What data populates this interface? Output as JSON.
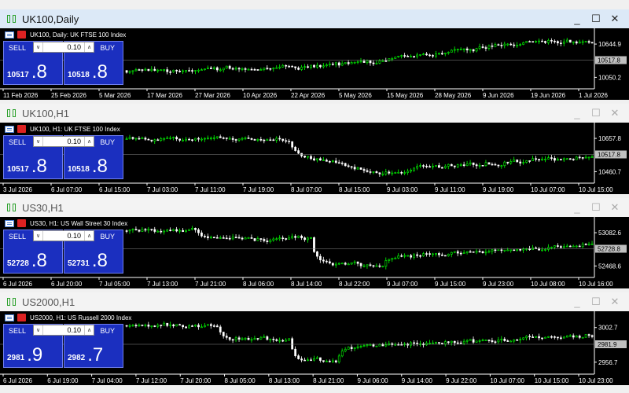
{
  "windows": [
    {
      "title": "UK100,Daily",
      "active": true,
      "header": "UK100, Daily:  UK FTSE 100 Index",
      "sell_label": "SELL",
      "buy_label": "BUY",
      "lot": "0.10",
      "sell_small": "10517",
      "sell_big": ".8",
      "buy_small": "10518",
      "buy_big": ".8",
      "y_ticks": [
        "10644.9",
        "10517.8",
        "10050.2"
      ],
      "current": "10517.8",
      "x_ticks": [
        "11 Feb 2026",
        "25 Feb 2026",
        "5 Mar 2026",
        "17 Mar 2026",
        "27 Mar 2026",
        "10 Apr 2026",
        "22 Apr 2026",
        "5 May 2026",
        "15 May 2026",
        "28 May 2026",
        "9 Jun 2026",
        "19 Jun 2026",
        "1 Jul 2026"
      ],
      "ctrls": [
        "_",
        "☐",
        "✕"
      ]
    },
    {
      "title": "UK100,H1",
      "active": false,
      "header": "UK100, H1:  UK FTSE 100 Index",
      "sell_label": "SELL",
      "buy_label": "BUY",
      "lot": "0.10",
      "sell_small": "10517",
      "sell_big": ".8",
      "buy_small": "10518",
      "buy_big": ".8",
      "y_ticks": [
        "10657.8",
        "10517.8",
        "10460.7"
      ],
      "current": "10517.8",
      "x_ticks": [
        "3 Jul 2026",
        "6 Jul 07:00",
        "6 Jul 15:00",
        "7 Jul 03:00",
        "7 Jul 11:00",
        "7 Jul 19:00",
        "8 Jul 07:00",
        "8 Jul 15:00",
        "9 Jul 03:00",
        "9 Jul 11:00",
        "9 Jul 19:00",
        "10 Jul 07:00",
        "10 Jul 15:00"
      ],
      "ctrls": [
        "_",
        "☐",
        "✕"
      ]
    },
    {
      "title": "US30,H1",
      "active": false,
      "header": "US30, H1:  US Wall Street 30 Index",
      "sell_label": "SELL",
      "buy_label": "BUY",
      "lot": "0.10",
      "sell_small": "52728",
      "sell_big": ".8",
      "buy_small": "52731",
      "buy_big": ".8",
      "y_ticks": [
        "53082.6",
        "52728.8",
        "52468.6"
      ],
      "current": "52728.8",
      "x_ticks": [
        "6 Jul 2026",
        "6 Jul 20:00",
        "7 Jul 05:00",
        "7 Jul 13:00",
        "7 Jul 21:00",
        "8 Jul 06:00",
        "8 Jul 14:00",
        "8 Jul 22:00",
        "9 Jul 07:00",
        "9 Jul 15:00",
        "9 Jul 23:00",
        "10 Jul 08:00",
        "10 Jul 16:00"
      ],
      "ctrls": [
        "_",
        "☐",
        "✕"
      ]
    },
    {
      "title": "US2000,H1",
      "active": false,
      "header": "US2000, H1:  US Russell 2000 Index",
      "sell_label": "SELL",
      "buy_label": "BUY",
      "lot": "0.10",
      "sell_small": "2981",
      "sell_big": ".9",
      "buy_small": "2982",
      "buy_big": ".7",
      "y_ticks": [
        "3002.7",
        "2981.9",
        "2956.7"
      ],
      "current": "2981.9",
      "x_ticks": [
        "6 Jul 2026",
        "6 Jul 19:00",
        "7 Jul 04:00",
        "7 Jul 12:00",
        "7 Jul 20:00",
        "8 Jul 05:00",
        "8 Jul 13:00",
        "8 Jul 21:00",
        "9 Jul 06:00",
        "9 Jul 14:00",
        "9 Jul 22:00",
        "10 Jul 07:00",
        "10 Jul 15:00",
        "10 Jul 23:00"
      ],
      "ctrls": [
        "_",
        "☐",
        "✕"
      ]
    }
  ],
  "colors": {
    "bull": "#00ff00",
    "bear": "#ffffff",
    "grid": "#3a3a3a",
    "axis": "#ffffff",
    "panel": "#1b2fbf"
  }
}
